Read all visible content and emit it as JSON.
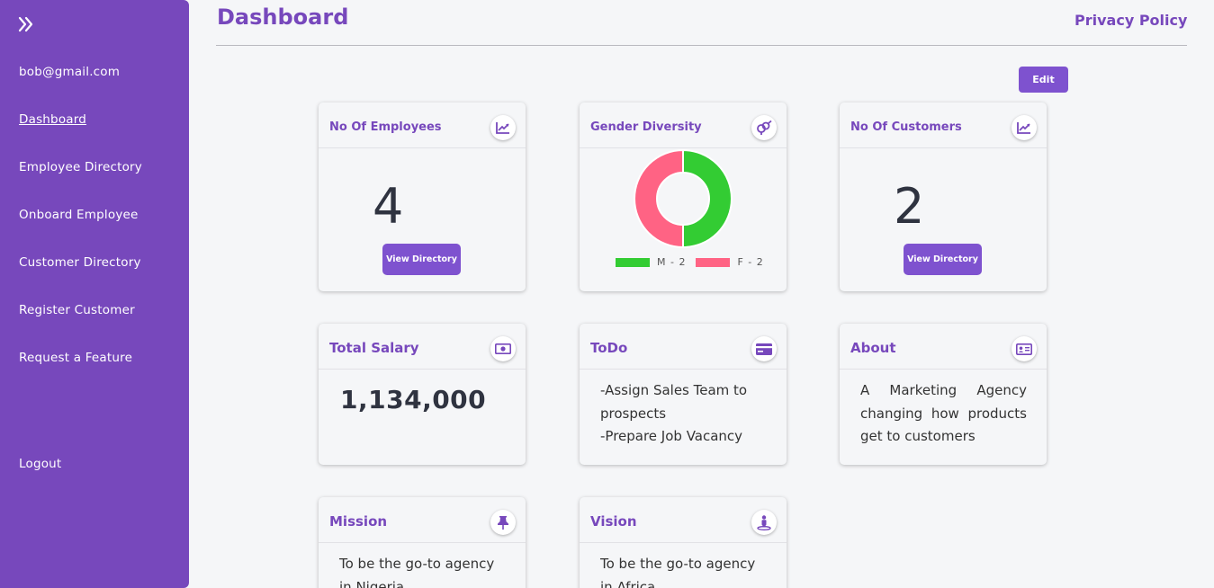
{
  "sidebar": {
    "user_email": "bob@gmail.com",
    "items": [
      {
        "label": "Dashboard"
      },
      {
        "label": "Employee Directory"
      },
      {
        "label": "Onboard Employee"
      },
      {
        "label": "Customer Directory"
      },
      {
        "label": "Register Customer"
      },
      {
        "label": "Request a Feature"
      }
    ],
    "logout_label": "Logout"
  },
  "header": {
    "title": "Dashboard",
    "privacy_label": "Privacy Policy"
  },
  "edit_label": "Edit",
  "cards": {
    "employees": {
      "title": "No Of Employees",
      "value": "4",
      "button": "View Directory"
    },
    "gender": {
      "title": "Gender Diversity",
      "male_label": "M - 2",
      "female_label": "F - 2",
      "male_count": 2,
      "female_count": 2,
      "male_color": "#33cc33",
      "female_color": "#ff6384"
    },
    "customers": {
      "title": "No Of Customers",
      "value": "2",
      "button": "View Directory"
    },
    "salary": {
      "title": "Total Salary",
      "value": "1,134,000"
    },
    "todo": {
      "title": "ToDo",
      "items": [
        "-Assign Sales Team to prospects",
        "-Prepare Job Vacancy"
      ]
    },
    "about": {
      "title": "About",
      "text": "A Marketing Agency changing how products get to customers"
    },
    "mission": {
      "title": "Mission",
      "text": "To be the go-to agency in Nigeria"
    },
    "vision": {
      "title": "Vision",
      "text": "To be the go-to agency in Africa"
    }
  },
  "icons": {
    "sidebar_toggle": "double-chevron-right-icon",
    "employees": "chart-line-icon",
    "gender": "venus-mars-icon",
    "customers": "chart-line-icon",
    "salary": "money-bill-icon",
    "todo": "credit-card-icon",
    "about": "id-card-icon",
    "mission": "thumbtack-icon",
    "vision": "street-view-icon"
  },
  "colors": {
    "brand": "#7748bc",
    "button": "#7e52cf",
    "background": "#f5f6f8"
  }
}
